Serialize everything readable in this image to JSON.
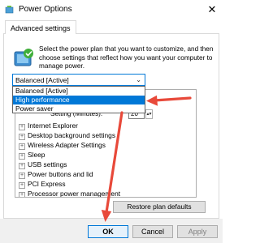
{
  "window": {
    "title": "Power Options",
    "close_glyph": "✕",
    "icon": "power-options-icon"
  },
  "tabs": [
    {
      "label": "Advanced settings",
      "active": true
    }
  ],
  "description": "Select the power plan that you want to customize, and then choose settings that reflect how you want your computer to manage power.",
  "plan_select": {
    "value": "Balanced [Active]",
    "arrow": "⌄",
    "open": true,
    "options": [
      {
        "label": "Balanced [Active]",
        "selected": false
      },
      {
        "label": "High performance",
        "selected": true
      },
      {
        "label": "Power saver",
        "selected": false
      }
    ]
  },
  "settings_tree": {
    "visible_setting_label": "Setting (Minutes):",
    "visible_setting_value": "20",
    "items": [
      "Internet Explorer",
      "Desktop background settings",
      "Wireless Adapter Settings",
      "Sleep",
      "USB settings",
      "Power buttons and lid",
      "PCI Express",
      "Processor power management"
    ],
    "expander_glyph": "+"
  },
  "buttons": {
    "restore": "Restore plan defaults",
    "ok": "OK",
    "cancel": "Cancel",
    "apply": "Apply"
  },
  "colors": {
    "accent": "#0078d7",
    "annotation_arrow": "#e8493a"
  }
}
